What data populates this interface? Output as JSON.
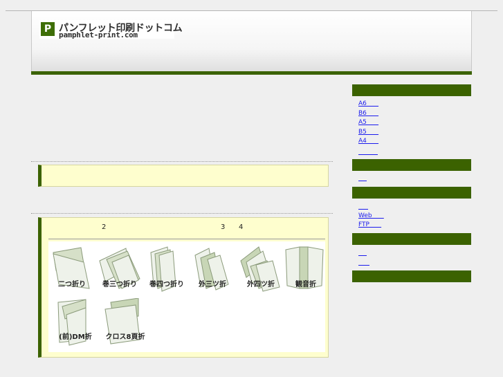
{
  "header": {
    "logo_icon_letter": "P",
    "logo_title": "パンフレット印刷ドットコム",
    "logo_subtitle": "pamphlet-print.com"
  },
  "main": {
    "heading_numbers": [
      "2",
      "3",
      "4"
    ],
    "fold_types": [
      {
        "label": "二つ折り",
        "icon": "two-fold-icon"
      },
      {
        "label": "巻三つ折り",
        "icon": "roll-three-fold-icon"
      },
      {
        "label": "巻四つ折り",
        "icon": "roll-four-fold-icon"
      },
      {
        "label": "外三ツ折",
        "icon": "z-three-fold-icon"
      },
      {
        "label": "外四ツ折",
        "icon": "z-four-fold-icon"
      },
      {
        "label": "観音折",
        "icon": "gate-fold-icon"
      },
      {
        "label": "(前)DM折",
        "icon": "dm-fold-icon"
      },
      {
        "label": "クロス8頁折",
        "icon": "cross-8-page-fold-icon"
      }
    ]
  },
  "sidebar": {
    "group1_links": [
      "A6",
      "B6",
      "A5",
      "B5",
      "A4",
      ""
    ],
    "group2_links": [
      ""
    ],
    "group3_links": [
      "",
      "Web",
      "FTP"
    ],
    "group4_links": [
      "",
      ""
    ]
  },
  "colors": {
    "brand_green": "#3b6200",
    "highlight_yellow": "#fefece",
    "link_blue": "#1a1aee"
  }
}
